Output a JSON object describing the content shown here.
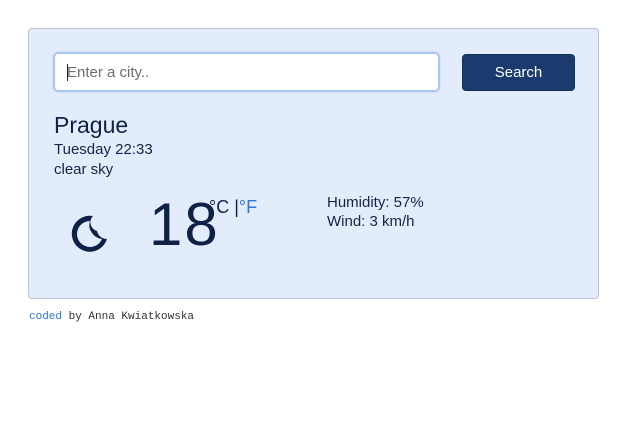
{
  "search": {
    "placeholder": "Enter a city..",
    "button_label": "Search"
  },
  "weather": {
    "city": "Prague",
    "datetime": "Tuesday 22:33",
    "description": "clear sky",
    "icon": "moon-icon",
    "temperature": "18",
    "unit_c": "°C",
    "unit_separator": "|",
    "unit_f": "°F",
    "humidity": "Humidity: 57%",
    "wind": "Wind: 3 km/h"
  },
  "footer": {
    "link_text": "coded",
    "rest_text": " by Anna Kwiatkowska"
  },
  "colors": {
    "card_bg": "#e3ecfa",
    "button_bg": "#1b3b6f",
    "text_dark": "#0f2146",
    "link": "#2f78d8"
  }
}
